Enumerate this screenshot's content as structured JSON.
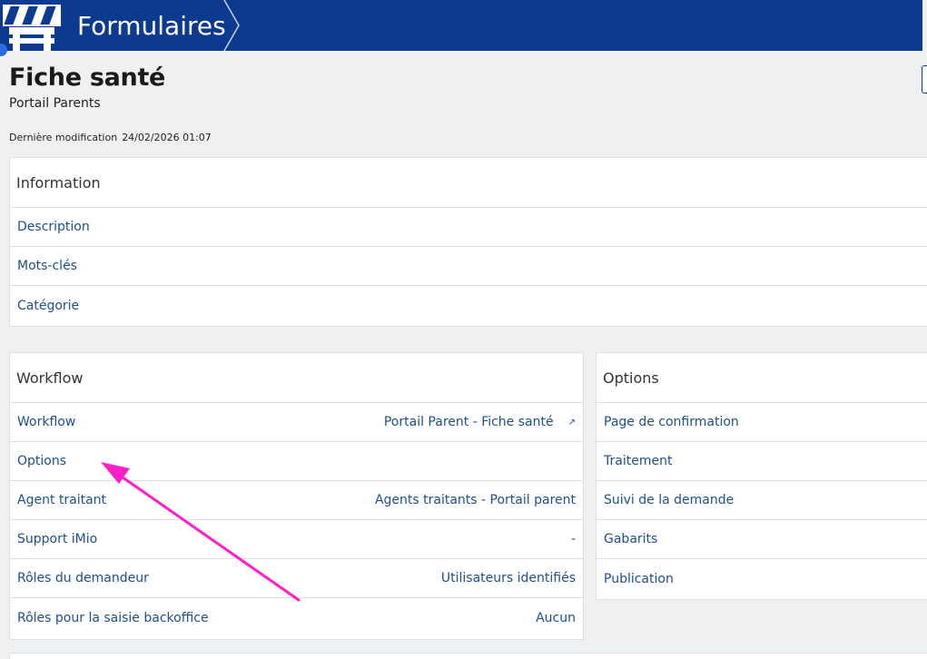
{
  "header": {
    "app_title": "Formulaires"
  },
  "page": {
    "title": "Fiche santé",
    "subtitle": "Portail Parents",
    "last_modified_label": "Dernière modification",
    "last_modified_value": "24/02/2026 01:07"
  },
  "information": {
    "heading": "Information",
    "rows": [
      {
        "label": "Description"
      },
      {
        "label": "Mots-clés"
      },
      {
        "label": "Catégorie"
      }
    ]
  },
  "workflow": {
    "heading": "Workflow",
    "rows": [
      {
        "label": "Workflow",
        "value": "Portail Parent - Fiche santé",
        "ext_icon": "external-link-icon"
      },
      {
        "label": "Options",
        "value": ""
      },
      {
        "label": "Agent traitant",
        "value": "Agents traitants - Portail parent"
      },
      {
        "label": "Support iMio",
        "value": "-"
      },
      {
        "label": "Rôles du demandeur",
        "value": "Utilisateurs identifiés"
      },
      {
        "label": "Rôles pour la saisie backoffice",
        "value": "Aucun"
      }
    ]
  },
  "options": {
    "heading": "Options",
    "rows": [
      {
        "label": "Page de confirmation"
      },
      {
        "label": "Traitement"
      },
      {
        "label": "Suivi de la demande"
      },
      {
        "label": "Gabarits"
      },
      {
        "label": "Publication"
      }
    ]
  },
  "annotation": {
    "arrow_color": "#ff1fc8"
  },
  "colors": {
    "header_bg": "#0b3a8e",
    "link": "#1e4e8c",
    "page_bg": "#eef0f2"
  }
}
